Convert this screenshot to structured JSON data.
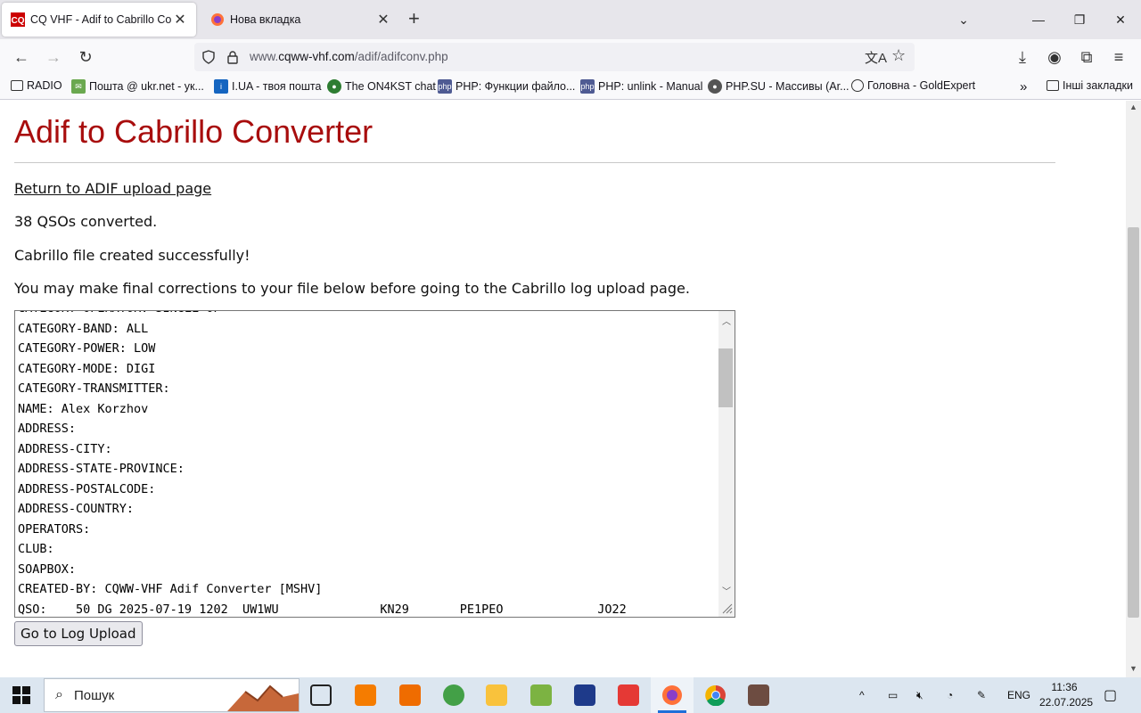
{
  "browser": {
    "tabs": [
      {
        "title": "CQ VHF - Adif to Cabrillo Conve",
        "active": true
      },
      {
        "title": "Нова вкладка",
        "active": false
      }
    ],
    "url_prefix": "www.",
    "url_host": "cqww-vhf.com",
    "url_path": "/adif/adifconv.php"
  },
  "bookmarks": [
    {
      "label": "RADIO",
      "icon": "folder-icon"
    },
    {
      "label": "Пошта @ ukr.net - ук...",
      "icon": "mail-icon"
    },
    {
      "label": "I.UA - твоя пошта",
      "icon": "info-icon"
    },
    {
      "label": "The ON4KST chat",
      "icon": "globe-icon"
    },
    {
      "label": "PHP: Функции файло...",
      "icon": "php-icon"
    },
    {
      "label": "PHP: unlink - Manual",
      "icon": "php-icon"
    },
    {
      "label": "PHP.SU - Массивы (Ar...",
      "icon": "php-su-icon"
    },
    {
      "label": "Головна - GoldExpert",
      "icon": "globe-icon"
    }
  ],
  "other_bookmarks": "Інші закладки",
  "page": {
    "heading": "Adif to Cabrillo Converter",
    "return_link": "Return to ADIF upload page",
    "qsos_converted": "38 QSOs converted.",
    "success_msg": "Cabrillo file created successfully!",
    "instructions": "You may make final corrections to your file below before going to the Cabrillo log upload page.",
    "cabrillo_text": "CATEGORY-OPERATOR: SINGLE-OP\nCATEGORY-BAND: ALL\nCATEGORY-POWER: LOW\nCATEGORY-MODE: DIGI\nCATEGORY-TRANSMITTER:\nNAME: Alex Korzhov\nADDRESS:\nADDRESS-CITY:\nADDRESS-STATE-PROVINCE:\nADDRESS-POSTALCODE:\nADDRESS-COUNTRY:\nOPERATORS:\nCLUB:\nSOAPBOX:\nCREATED-BY: CQWW-VHF Adif Converter [MSHV]\nQSO:    50 DG 2025-07-19 1202  UW1WU              KN29       PE1PEO             JO22",
    "button": "Go to Log Upload"
  },
  "taskbar": {
    "search_placeholder": "Пошук",
    "lang": "ENG",
    "time": "11:36",
    "date": "22.07.2025"
  }
}
